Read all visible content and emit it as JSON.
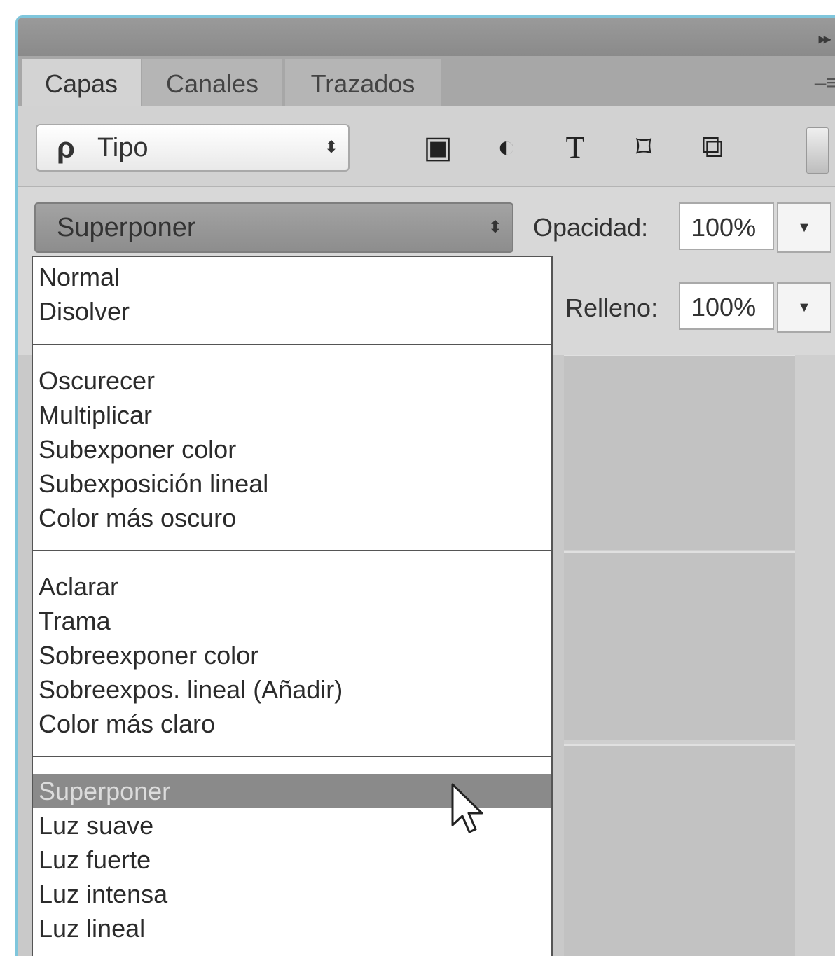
{
  "panel": {
    "collapse_glyph": "▸▸",
    "menu_glyph": "–≡",
    "tabs": [
      {
        "label": "Capas",
        "active": true
      },
      {
        "label": "Canales",
        "active": false
      },
      {
        "label": "Trazados",
        "active": false
      }
    ]
  },
  "filter": {
    "search_glyph": "ρ",
    "type_label": "Tipo",
    "arrows": "⬍",
    "icons": [
      {
        "name": "image-filter-icon",
        "glyph": "▣"
      },
      {
        "name": "adjustment-filter-icon",
        "glyph": "◐"
      },
      {
        "name": "type-filter-icon",
        "glyph": "T"
      },
      {
        "name": "shape-filter-icon",
        "glyph": "⌑"
      },
      {
        "name": "smart-object-filter-icon",
        "glyph": "⧉"
      }
    ]
  },
  "blend_mode": {
    "selected": "Superponer",
    "arrows": "⬍"
  },
  "opacity": {
    "label": "Opacidad:",
    "value": "100%",
    "arrow": "▼"
  },
  "fill": {
    "label": "Relleno:",
    "value": "100%",
    "arrow": "▼"
  },
  "menu": {
    "groups": [
      [
        "Normal",
        "Disolver"
      ],
      [
        "Oscurecer",
        "Multiplicar",
        "Subexponer color",
        "Subexposición lineal",
        "Color más oscuro"
      ],
      [
        "Aclarar",
        "Trama",
        "Sobreexponer color",
        "Sobreexpos. lineal (Añadir)",
        "Color más claro"
      ],
      [
        "Superponer",
        "Luz suave",
        "Luz fuerte",
        "Luz intensa",
        "Luz lineal"
      ]
    ],
    "highlighted": "Superponer"
  }
}
